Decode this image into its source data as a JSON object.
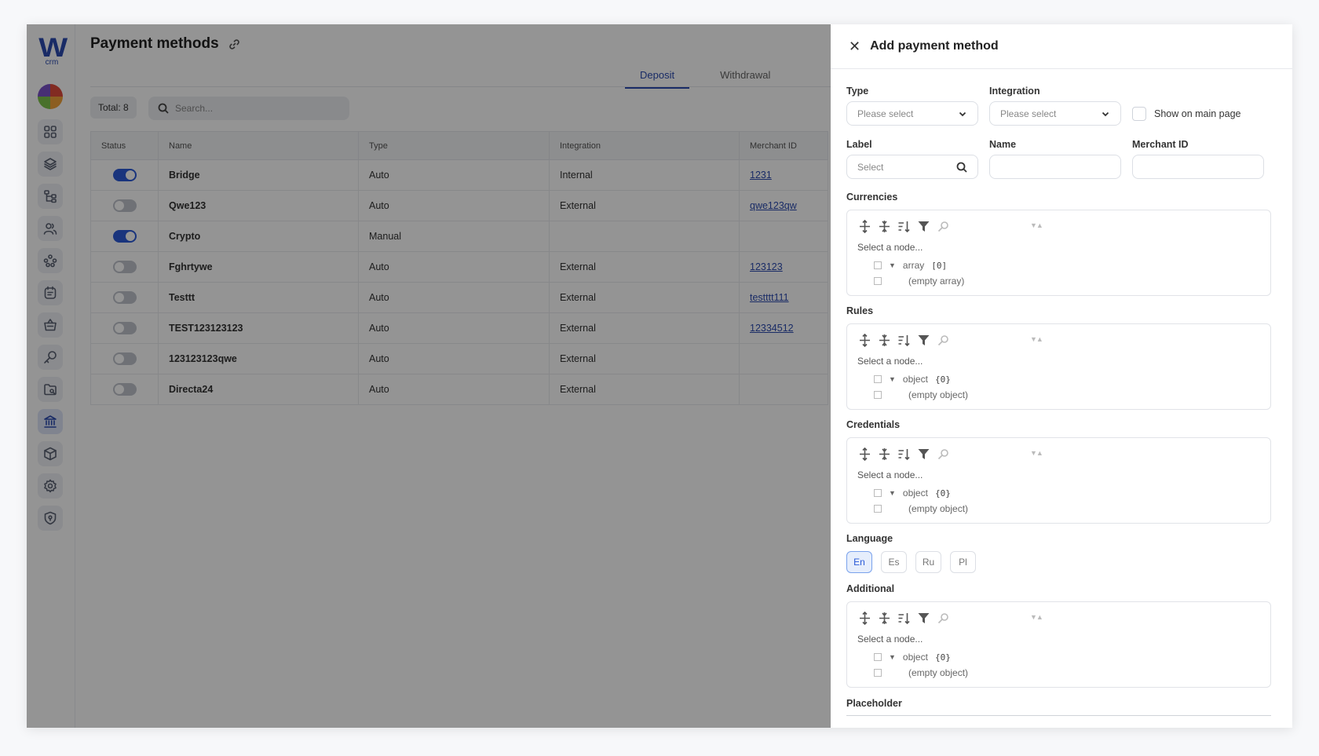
{
  "brand": {
    "logo_letter": "W",
    "logo_sub": "crm"
  },
  "sidebar": {
    "items": [
      {
        "name": "dashboard-icon"
      },
      {
        "name": "layers-icon"
      },
      {
        "name": "hierarchy-icon"
      },
      {
        "name": "users-icon"
      },
      {
        "name": "network-icon"
      },
      {
        "name": "notes-icon"
      },
      {
        "name": "basket-icon"
      },
      {
        "name": "key-icon"
      },
      {
        "name": "folder-icon"
      },
      {
        "name": "bank-icon",
        "active": true
      },
      {
        "name": "box-icon"
      },
      {
        "name": "settings-icon"
      },
      {
        "name": "shield-icon"
      }
    ]
  },
  "page": {
    "title": "Payment methods"
  },
  "tabs": [
    {
      "label": "Deposit",
      "active": true
    },
    {
      "label": "Withdrawal",
      "active": false
    }
  ],
  "toolbar": {
    "total": "Total: 8",
    "search_placeholder": "Search..."
  },
  "table": {
    "columns": [
      "Status",
      "Name",
      "Type",
      "Integration",
      "Merchant ID"
    ],
    "rows": [
      {
        "enabled": true,
        "name": "Bridge",
        "type": "Auto",
        "integration": "Internal",
        "merchant": "1231"
      },
      {
        "enabled": false,
        "name": "Qwe123",
        "type": "Auto",
        "integration": "External",
        "merchant": "qwe123qw"
      },
      {
        "enabled": true,
        "name": "Crypto",
        "type": "Manual",
        "integration": "",
        "merchant": ""
      },
      {
        "enabled": false,
        "name": "Fghrtywe",
        "type": "Auto",
        "integration": "External",
        "merchant": "123123"
      },
      {
        "enabled": false,
        "name": "Testtt",
        "type": "Auto",
        "integration": "External",
        "merchant": "testttt111"
      },
      {
        "enabled": false,
        "name": "TEST123123123",
        "type": "Auto",
        "integration": "External",
        "merchant": "12334512"
      },
      {
        "enabled": false,
        "name": "123123123qwe",
        "type": "Auto",
        "integration": "External",
        "merchant": ""
      },
      {
        "enabled": false,
        "name": "Directa24",
        "type": "Auto",
        "integration": "External",
        "merchant": ""
      }
    ]
  },
  "panel": {
    "title": "Add payment method",
    "type": {
      "label": "Type",
      "placeholder": "Please select"
    },
    "integration": {
      "label": "Integration",
      "placeholder": "Please select"
    },
    "show_main": {
      "label": "Show on main page",
      "checked": false
    },
    "label_field": {
      "label": "Label",
      "placeholder": "Select"
    },
    "name_field": {
      "label": "Name",
      "value": ""
    },
    "merchant_field": {
      "label": "Merchant ID",
      "value": ""
    },
    "editors": [
      {
        "label": "Currencies",
        "select_text": "Select a node...",
        "root": "array",
        "count": "[0]",
        "empty": "(empty array)"
      },
      {
        "label": "Rules",
        "select_text": "Select a node...",
        "root": "object",
        "count": "{0}",
        "empty": "(empty object)"
      },
      {
        "label": "Credentials",
        "select_text": "Select a node...",
        "root": "object",
        "count": "{0}",
        "empty": "(empty object)"
      },
      {
        "label": "Additional",
        "select_text": "Select a node...",
        "root": "object",
        "count": "{0}",
        "empty": "(empty object)"
      }
    ],
    "language": {
      "label": "Language",
      "options": [
        "En",
        "Es",
        "Ru",
        "Pl"
      ],
      "selected": "En"
    },
    "placeholder_label": "Placeholder"
  },
  "colors": {
    "accent": "#2b5bd7",
    "brand": "#2b4bb0",
    "overlay": "rgba(0,0,0,0.42)"
  }
}
